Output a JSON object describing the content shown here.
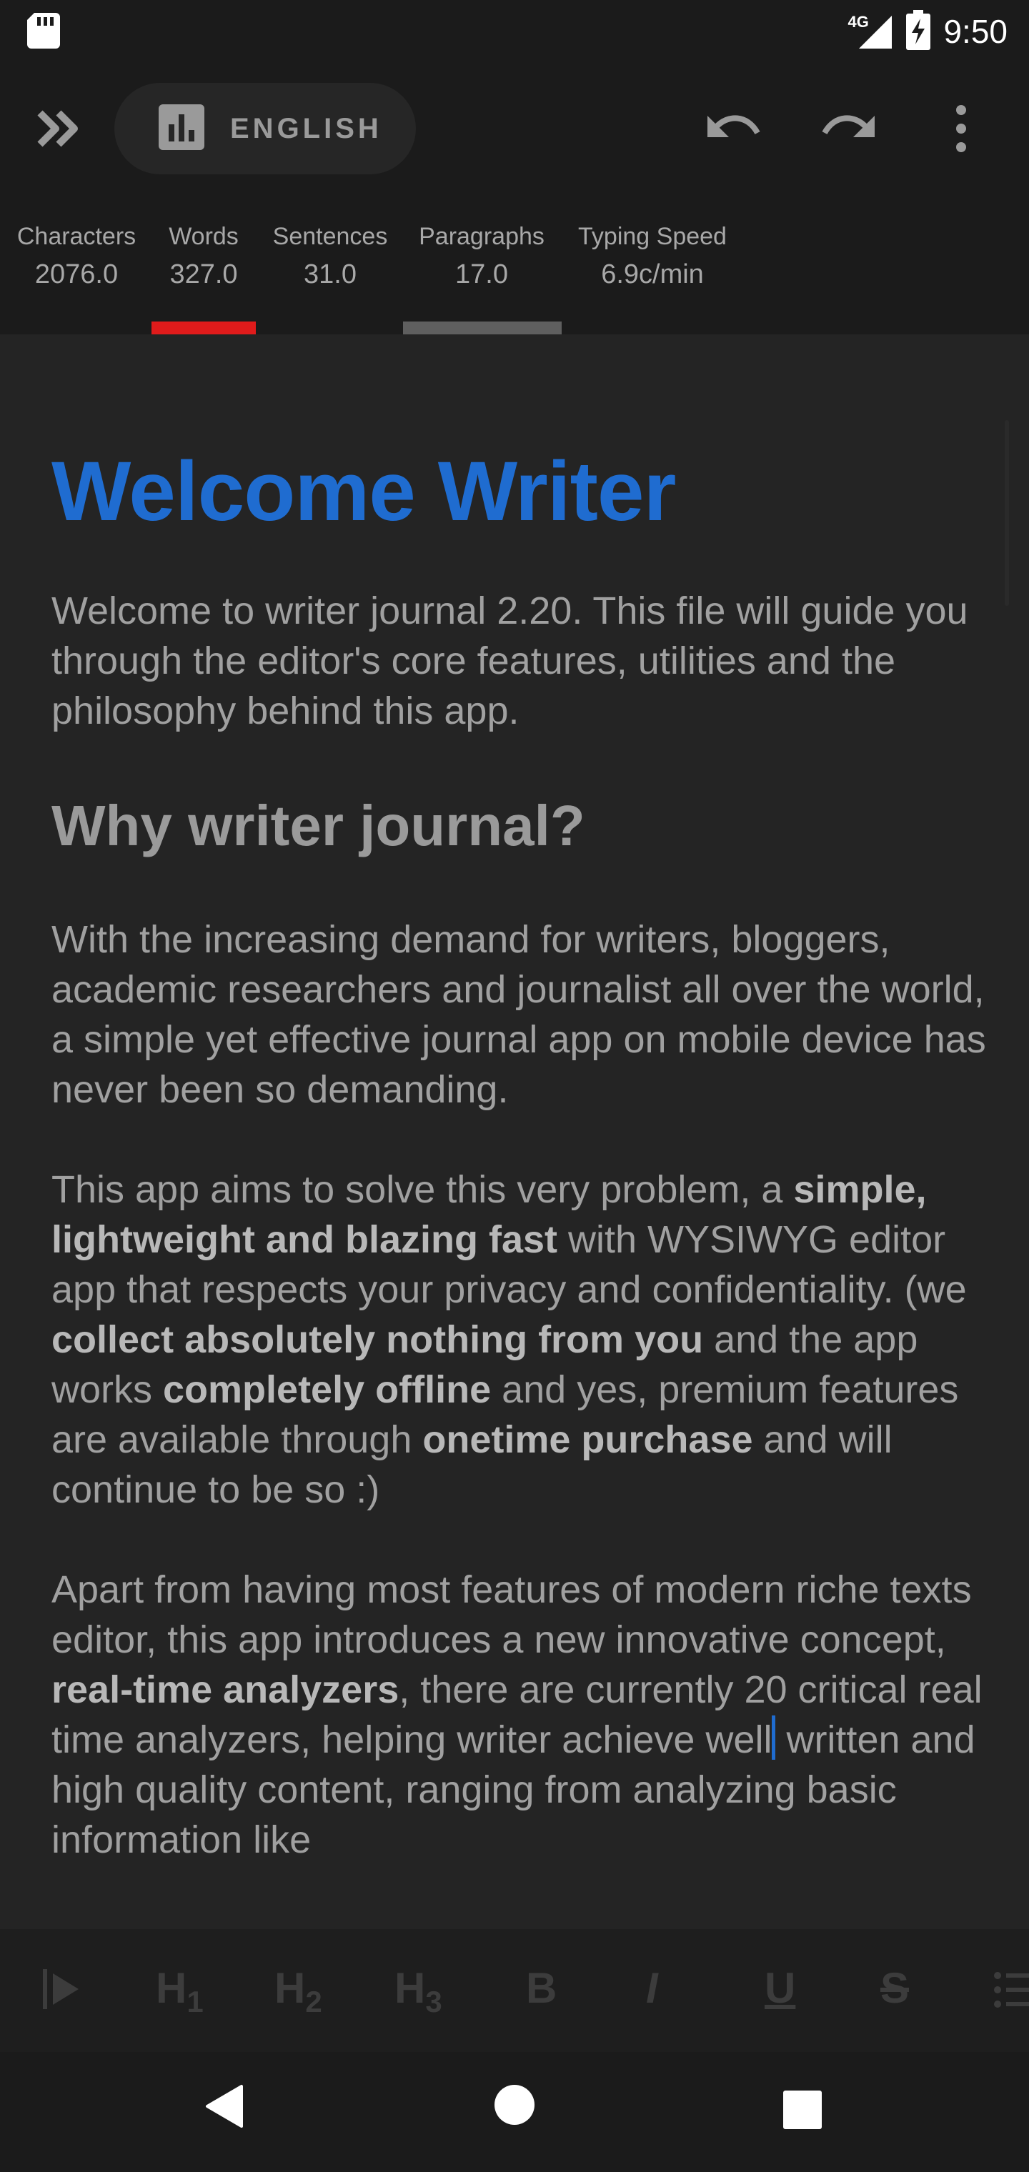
{
  "status_bar": {
    "network": "4G",
    "time": "9:50"
  },
  "toolbar": {
    "language": "ENGLISH",
    "icons": [
      "double-chevron-icon",
      "bar-chart-icon",
      "undo-icon",
      "redo-icon",
      "more-vert-icon"
    ]
  },
  "stats": [
    {
      "label": "Characters",
      "value": "2076.0"
    },
    {
      "label": "Words",
      "value": "327.0"
    },
    {
      "label": "Sentences",
      "value": "31.0"
    },
    {
      "label": "Paragraphs",
      "value": "17.0"
    },
    {
      "label": "Typing Speed",
      "value": "6.9c/min"
    }
  ],
  "document": {
    "title": "Welcome Writer",
    "intro": "Welcome to writer journal 2.20. This file will guide you through the editor's core features, utilities and the philosophy behind this app.",
    "heading": "Why writer journal?",
    "para2": "With the increasing demand for writers, bloggers, academic researchers and journalist all over the world, a simple yet effective journal app on mobile device has never been so demanding.",
    "para3": {
      "t1": "This app aims to solve this very problem, a ",
      "b1": "simple, lightweight and blazing fast",
      "t2": " with WYSIWYG editor app that respects your privacy and confidentiality. (we ",
      "b2": "collect absolutely nothing from you",
      "t3": " and the app works ",
      "b3": "completely offline",
      "t4": " and yes, premium features are available through ",
      "b4": "onetime purchase",
      "t5": " and will continue to be so :)"
    },
    "para4": {
      "t1": "Apart from having most features of modern riche texts editor, this app introduces a new innovative concept, ",
      "b1": "real-time analyzers",
      "t2": ", there are currently 20 critical real time analyzers, helping writer achieve well",
      "t3": " written and high quality content, ranging from analyzing basic information like"
    }
  },
  "format_bar": {
    "h1": "H",
    "h1_num": "1",
    "h2": "H",
    "h2_num": "2",
    "h3": "H",
    "h3_num": "3",
    "bold": "B",
    "italic": "I",
    "underline": "U",
    "strike": "S"
  },
  "colors": {
    "accent": "#1f6cd0",
    "active_tab": "#e01b1b",
    "background": "#242424"
  }
}
